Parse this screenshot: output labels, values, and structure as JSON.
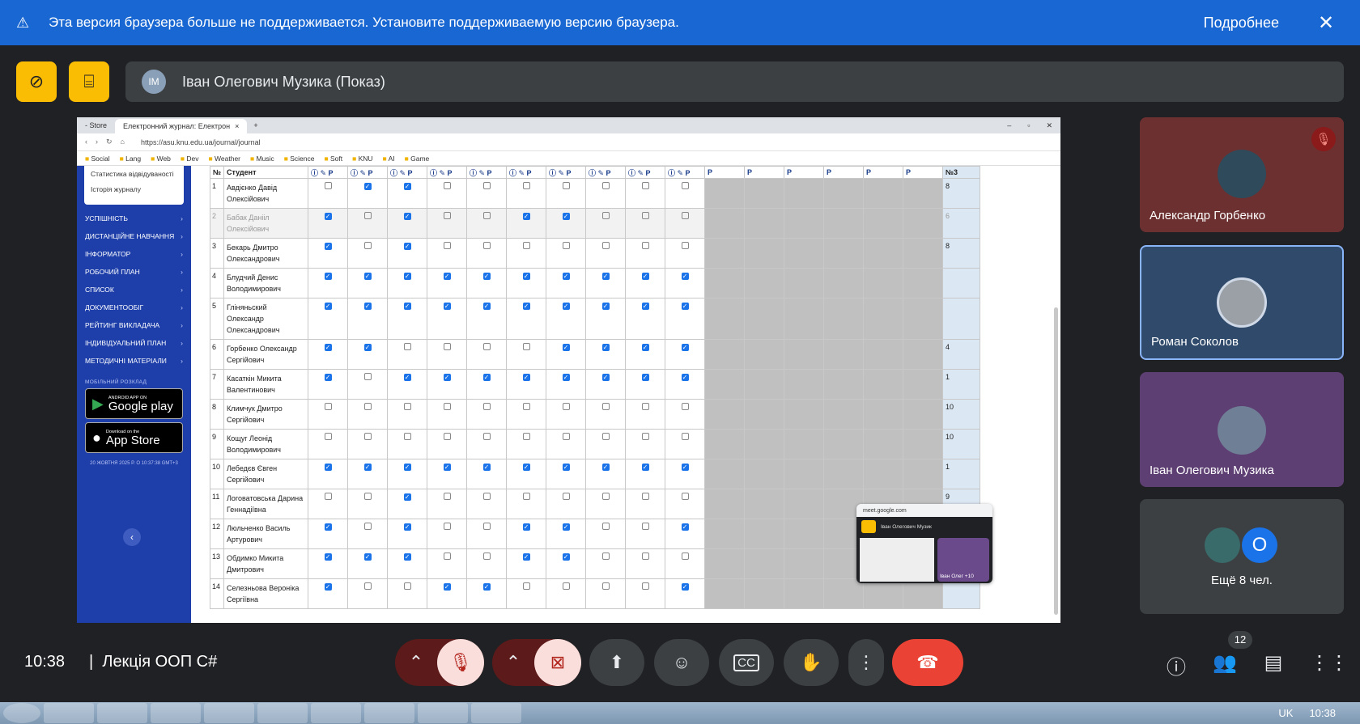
{
  "banner": {
    "message": "Эта версия браузера больше не поддерживается. Установите поддерживаемую версию браузера.",
    "more": "Подробнее"
  },
  "presenter": {
    "name": "Іван Олегович Музика (Показ)"
  },
  "browser": {
    "tabs": [
      "- Store",
      "Електронний журнал: Електрон"
    ],
    "url": "https://asu.knu.edu.ua/journal/journal",
    "bookmarks": [
      "Social",
      "Lang",
      "Web",
      "Dev",
      "Weather",
      "Music",
      "Science",
      "Soft",
      "KNU",
      "AI",
      "Game"
    ]
  },
  "sidebar": {
    "card_items": [
      "Статистика відвідуваності",
      "Історія журналу"
    ],
    "menu": [
      "УСПІШНІСТЬ",
      "ДИСТАНЦІЙНЕ НАВЧАННЯ",
      "ІНФОРМАТОР",
      "РОБОЧИЙ ПЛАН",
      "СПИСОК",
      "ДОКУМЕНТООБІГ",
      "РЕЙТИНГ ВИКЛАДАЧА",
      "ІНДИВІДУАЛЬНИЙ ПЛАН",
      "МЕТОДИЧНІ МАТЕРІАЛИ"
    ],
    "mobile_label": "МОБІЛЬНИЙ РОЗКЛАД",
    "google_small": "ANDROID APP ON",
    "google_big": "Google play",
    "apple_small": "Download on the",
    "apple_big": "App Store",
    "date": "20 ЖОВТНЯ 2025 Р. О 10:37:38 GMT+3"
  },
  "journal": {
    "header_no": "№",
    "header_student": "Студент",
    "header_score": "№3",
    "rows": [
      {
        "n": "1",
        "name": "Авдієнко Давід Олексійович",
        "checks": [
          0,
          1,
          1,
          0,
          0,
          0,
          0,
          0,
          0,
          0
        ],
        "score": "8"
      },
      {
        "n": "2",
        "name": "Бабак Данііл Олексійович",
        "checks": [
          1,
          0,
          1,
          0,
          0,
          1,
          1,
          0,
          0,
          0
        ],
        "score": "6",
        "dim": true
      },
      {
        "n": "3",
        "name": "Бекарь Дмитро Олександрович",
        "checks": [
          1,
          0,
          1,
          0,
          0,
          0,
          0,
          0,
          0,
          0
        ],
        "score": "8"
      },
      {
        "n": "4",
        "name": "Блудчий Денис Володимирович",
        "checks": [
          1,
          1,
          1,
          1,
          1,
          1,
          1,
          1,
          1,
          1
        ],
        "score": ""
      },
      {
        "n": "5",
        "name": "Гліняньский Олександр Олександрович",
        "checks": [
          1,
          1,
          1,
          1,
          1,
          1,
          1,
          1,
          1,
          1
        ],
        "score": ""
      },
      {
        "n": "6",
        "name": "Горбенко Олександр Сергійович",
        "checks": [
          1,
          1,
          0,
          0,
          0,
          0,
          1,
          1,
          1,
          1
        ],
        "score": "4"
      },
      {
        "n": "7",
        "name": "Касаткін Микита Валентинович",
        "checks": [
          1,
          0,
          1,
          1,
          1,
          1,
          1,
          1,
          1,
          1
        ],
        "score": "1"
      },
      {
        "n": "8",
        "name": "Климчук Дмитро Сергійович",
        "checks": [
          0,
          0,
          0,
          0,
          0,
          0,
          0,
          0,
          0,
          0
        ],
        "score": "10"
      },
      {
        "n": "9",
        "name": "Кощуг Леонід Володимирович",
        "checks": [
          0,
          0,
          0,
          0,
          0,
          0,
          0,
          0,
          0,
          0
        ],
        "score": "10"
      },
      {
        "n": "10",
        "name": "Лебедєв Євген Сергійович",
        "checks": [
          1,
          1,
          1,
          1,
          1,
          1,
          1,
          1,
          1,
          1
        ],
        "score": "1"
      },
      {
        "n": "11",
        "name": "Логоватовська Дарина Геннадіївна",
        "checks": [
          0,
          0,
          1,
          0,
          0,
          0,
          0,
          0,
          0,
          0
        ],
        "score": "9"
      },
      {
        "n": "12",
        "name": "Люльченко Василь Артурович",
        "checks": [
          1,
          0,
          1,
          0,
          0,
          1,
          1,
          0,
          0,
          1
        ],
        "score": ""
      },
      {
        "n": "13",
        "name": "Обдимко Микита Дмитрович",
        "checks": [
          1,
          1,
          1,
          0,
          0,
          1,
          1,
          0,
          0,
          0
        ],
        "score": ""
      },
      {
        "n": "14",
        "name": "Селезньова Вероніка Сергіївна",
        "checks": [
          1,
          0,
          0,
          1,
          1,
          0,
          0,
          0,
          0,
          1
        ],
        "score": ""
      }
    ]
  },
  "pip": {
    "domain": "meet.google.com",
    "presenter": "Іван Олегович Музик",
    "me": "Іван Олег",
    "count": "+10"
  },
  "participants": [
    {
      "name": "Александр Горбенко"
    },
    {
      "name": "Роман Соколов"
    },
    {
      "name": "Іван Олегович Музика"
    }
  ],
  "more": {
    "label": "Ещё 8 чел.",
    "initial": "O"
  },
  "bottom": {
    "time": "10:38",
    "meeting": "Лекція ООП С#",
    "people_count": "12"
  },
  "taskbar": {
    "lang": "UK",
    "clock": "10:38"
  }
}
